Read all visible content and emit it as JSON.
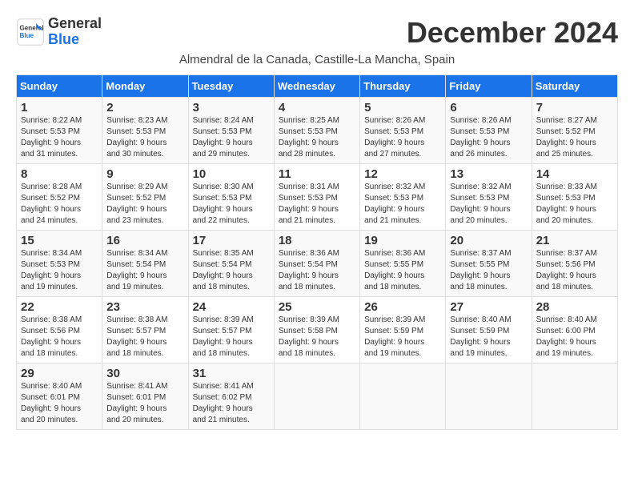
{
  "logo": {
    "line1": "General",
    "line2": "Blue"
  },
  "title": "December 2024",
  "location": "Almendral de la Canada, Castille-La Mancha, Spain",
  "weekdays": [
    "Sunday",
    "Monday",
    "Tuesday",
    "Wednesday",
    "Thursday",
    "Friday",
    "Saturday"
  ],
  "weeks": [
    [
      {
        "day": "1",
        "info": "Sunrise: 8:22 AM\nSunset: 5:53 PM\nDaylight: 9 hours\nand 31 minutes."
      },
      {
        "day": "2",
        "info": "Sunrise: 8:23 AM\nSunset: 5:53 PM\nDaylight: 9 hours\nand 30 minutes."
      },
      {
        "day": "3",
        "info": "Sunrise: 8:24 AM\nSunset: 5:53 PM\nDaylight: 9 hours\nand 29 minutes."
      },
      {
        "day": "4",
        "info": "Sunrise: 8:25 AM\nSunset: 5:53 PM\nDaylight: 9 hours\nand 28 minutes."
      },
      {
        "day": "5",
        "info": "Sunrise: 8:26 AM\nSunset: 5:53 PM\nDaylight: 9 hours\nand 27 minutes."
      },
      {
        "day": "6",
        "info": "Sunrise: 8:26 AM\nSunset: 5:53 PM\nDaylight: 9 hours\nand 26 minutes."
      },
      {
        "day": "7",
        "info": "Sunrise: 8:27 AM\nSunset: 5:52 PM\nDaylight: 9 hours\nand 25 minutes."
      }
    ],
    [
      {
        "day": "8",
        "info": "Sunrise: 8:28 AM\nSunset: 5:52 PM\nDaylight: 9 hours\nand 24 minutes."
      },
      {
        "day": "9",
        "info": "Sunrise: 8:29 AM\nSunset: 5:52 PM\nDaylight: 9 hours\nand 23 minutes."
      },
      {
        "day": "10",
        "info": "Sunrise: 8:30 AM\nSunset: 5:53 PM\nDaylight: 9 hours\nand 22 minutes."
      },
      {
        "day": "11",
        "info": "Sunrise: 8:31 AM\nSunset: 5:53 PM\nDaylight: 9 hours\nand 21 minutes."
      },
      {
        "day": "12",
        "info": "Sunrise: 8:32 AM\nSunset: 5:53 PM\nDaylight: 9 hours\nand 21 minutes."
      },
      {
        "day": "13",
        "info": "Sunrise: 8:32 AM\nSunset: 5:53 PM\nDaylight: 9 hours\nand 20 minutes."
      },
      {
        "day": "14",
        "info": "Sunrise: 8:33 AM\nSunset: 5:53 PM\nDaylight: 9 hours\nand 20 minutes."
      }
    ],
    [
      {
        "day": "15",
        "info": "Sunrise: 8:34 AM\nSunset: 5:53 PM\nDaylight: 9 hours\nand 19 minutes."
      },
      {
        "day": "16",
        "info": "Sunrise: 8:34 AM\nSunset: 5:54 PM\nDaylight: 9 hours\nand 19 minutes."
      },
      {
        "day": "17",
        "info": "Sunrise: 8:35 AM\nSunset: 5:54 PM\nDaylight: 9 hours\nand 18 minutes."
      },
      {
        "day": "18",
        "info": "Sunrise: 8:36 AM\nSunset: 5:54 PM\nDaylight: 9 hours\nand 18 minutes."
      },
      {
        "day": "19",
        "info": "Sunrise: 8:36 AM\nSunset: 5:55 PM\nDaylight: 9 hours\nand 18 minutes."
      },
      {
        "day": "20",
        "info": "Sunrise: 8:37 AM\nSunset: 5:55 PM\nDaylight: 9 hours\nand 18 minutes."
      },
      {
        "day": "21",
        "info": "Sunrise: 8:37 AM\nSunset: 5:56 PM\nDaylight: 9 hours\nand 18 minutes."
      }
    ],
    [
      {
        "day": "22",
        "info": "Sunrise: 8:38 AM\nSunset: 5:56 PM\nDaylight: 9 hours\nand 18 minutes."
      },
      {
        "day": "23",
        "info": "Sunrise: 8:38 AM\nSunset: 5:57 PM\nDaylight: 9 hours\nand 18 minutes."
      },
      {
        "day": "24",
        "info": "Sunrise: 8:39 AM\nSunset: 5:57 PM\nDaylight: 9 hours\nand 18 minutes."
      },
      {
        "day": "25",
        "info": "Sunrise: 8:39 AM\nSunset: 5:58 PM\nDaylight: 9 hours\nand 18 minutes."
      },
      {
        "day": "26",
        "info": "Sunrise: 8:39 AM\nSunset: 5:59 PM\nDaylight: 9 hours\nand 19 minutes."
      },
      {
        "day": "27",
        "info": "Sunrise: 8:40 AM\nSunset: 5:59 PM\nDaylight: 9 hours\nand 19 minutes."
      },
      {
        "day": "28",
        "info": "Sunrise: 8:40 AM\nSunset: 6:00 PM\nDaylight: 9 hours\nand 19 minutes."
      }
    ],
    [
      {
        "day": "29",
        "info": "Sunrise: 8:40 AM\nSunset: 6:01 PM\nDaylight: 9 hours\nand 20 minutes."
      },
      {
        "day": "30",
        "info": "Sunrise: 8:41 AM\nSunset: 6:01 PM\nDaylight: 9 hours\nand 20 minutes."
      },
      {
        "day": "31",
        "info": "Sunrise: 8:41 AM\nSunset: 6:02 PM\nDaylight: 9 hours\nand 21 minutes."
      },
      {
        "day": "",
        "info": ""
      },
      {
        "day": "",
        "info": ""
      },
      {
        "day": "",
        "info": ""
      },
      {
        "day": "",
        "info": ""
      }
    ]
  ]
}
